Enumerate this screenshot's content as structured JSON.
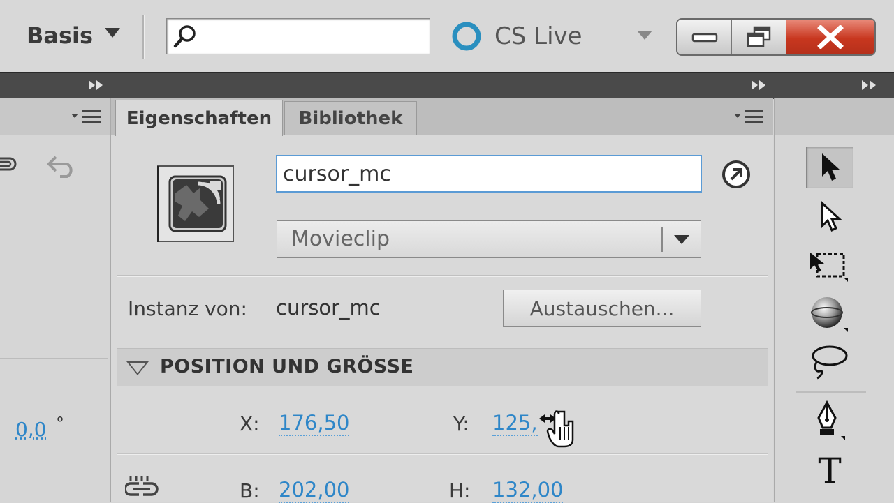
{
  "topbar": {
    "workspace": "Basis",
    "search_placeholder": "",
    "cslive_label": "CS Live"
  },
  "panels": {
    "properties": {
      "tabs": [
        {
          "label": "Eigenschaften",
          "active": true
        },
        {
          "label": "Bibliothek",
          "active": false
        }
      ],
      "instance_name": "cursor_mc",
      "symbol_type": "Movieclip",
      "instance_of_label": "Instanz von:",
      "instance_of_value": "cursor_mc",
      "swap_button": "Austauschen...",
      "section_title": "POSITION UND GRÖSSE",
      "x_label": "X:",
      "x_value": "176,50",
      "y_label": "Y:",
      "y_value": "125,",
      "w_label": "B:",
      "w_value": "202,00",
      "h_label": "H:",
      "h_value": "132,00"
    },
    "left": {
      "rotation_value": "0,0",
      "rotation_unit": "°"
    },
    "tools": {
      "text_tool": "T"
    }
  },
  "colors": {
    "accent_blue": "#2e86c8",
    "close_red": "#c8371f",
    "panel_bg": "#d9d9d9"
  }
}
